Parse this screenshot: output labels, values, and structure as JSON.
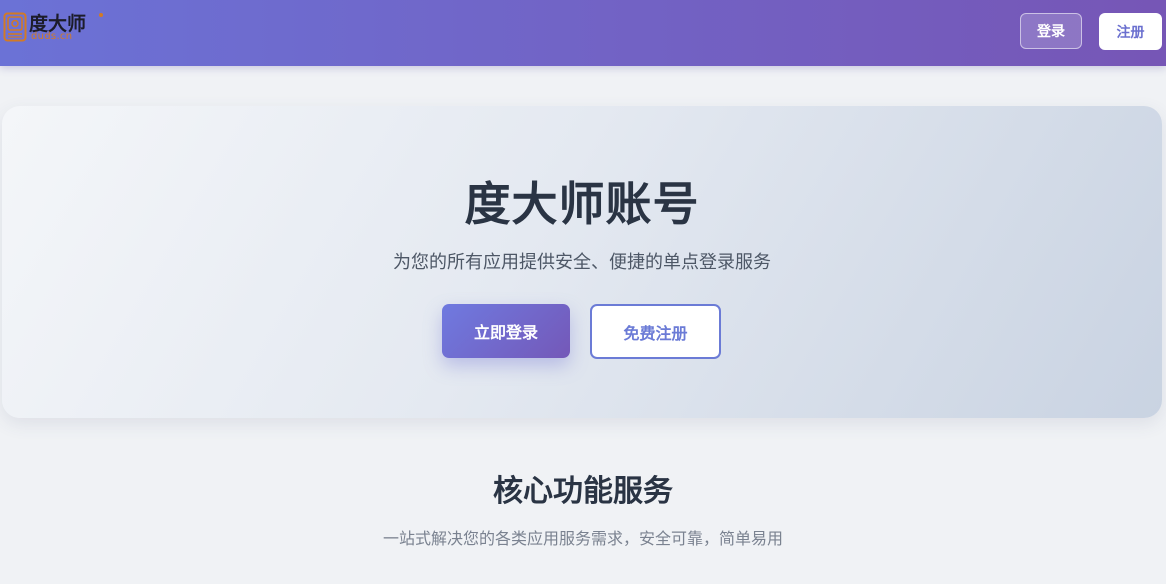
{
  "header": {
    "logo": {
      "name": "度大师",
      "domain": "duds.cn",
      "icon": "logo-mark-icon",
      "accent_color": "#d27a25"
    },
    "login_label": "登录",
    "register_label": "注册",
    "gradient": [
      "#6b72d6",
      "#7656b6"
    ]
  },
  "hero": {
    "title": "度大师账号",
    "subtitle": "为您的所有应用提供安全、便捷的单点登录服务",
    "login_button": "立即登录",
    "register_button": "免费注册",
    "primary_color": "#6f7ae0",
    "outline_color": "#6b7bd6"
  },
  "features": {
    "title": "核心功能服务",
    "subtitle": "一站式解决您的各类应用服务需求，安全可靠，简单易用"
  }
}
